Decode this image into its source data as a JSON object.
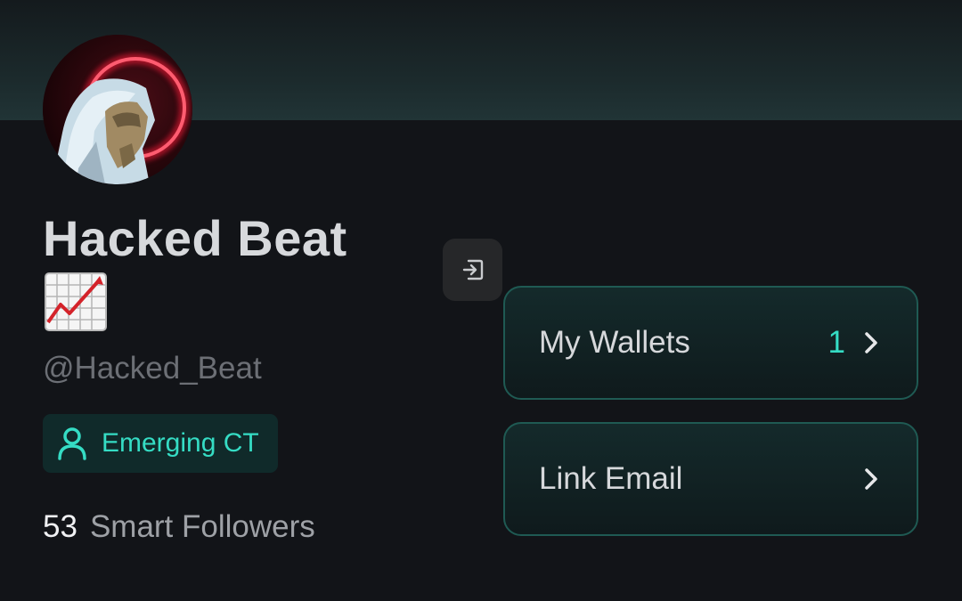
{
  "profile": {
    "display_name": "Hacked Beat",
    "name_emoji": "chart-increasing-icon",
    "handle": "@Hacked_Beat",
    "badge": {
      "icon": "person-icon",
      "label": "Emerging CT"
    },
    "smart_followers": {
      "count": "53",
      "label": "Smart Followers"
    }
  },
  "actions": {
    "logout_icon": "logout-icon",
    "my_wallets": {
      "label": "My Wallets",
      "count": "1"
    },
    "link_email": {
      "label": "Link Email"
    }
  },
  "colors": {
    "background": "#121418",
    "accent": "#35dcc4",
    "card_border": "#1f5a53",
    "badge_bg": "#102a2a"
  }
}
